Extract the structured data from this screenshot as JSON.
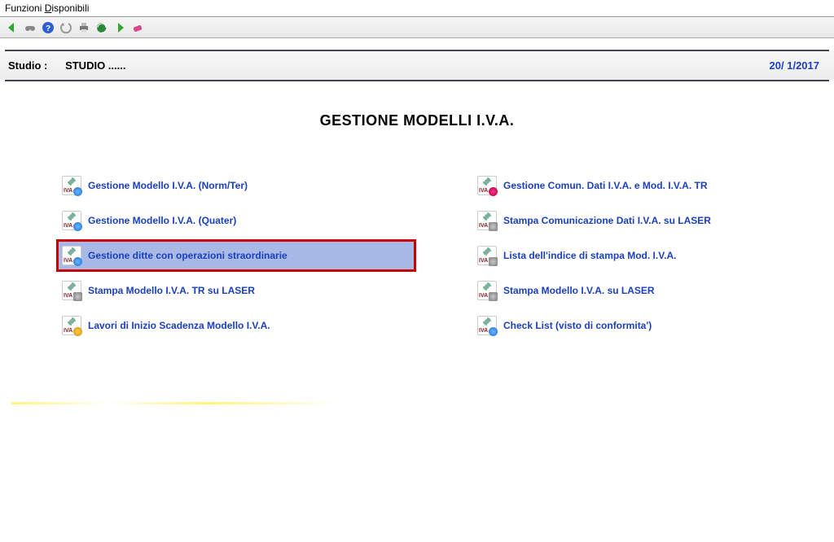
{
  "window": {
    "title_prefix": "Funzioni ",
    "title_underlined": "D",
    "title_suffix": "isponibili"
  },
  "toolbar": {
    "back": "back",
    "binoculars": "find",
    "help": "help",
    "undo": "undo",
    "print": "print",
    "refresh": "refresh",
    "forward": "forward",
    "delete": "delete"
  },
  "info": {
    "studio_label": "Studio :",
    "studio_value": "STUDIO ......",
    "date": "20/ 1/2017"
  },
  "page_title": "GESTIONE MODELLI I.V.A.",
  "left_items": [
    {
      "label": "Gestione Modello I.V.A. (Norm/Ter)",
      "badge": "blue"
    },
    {
      "label": "Gestione Modello I.V.A. (Quater)",
      "badge": "blue"
    },
    {
      "label": "Gestione ditte con operazioni straordinarie",
      "badge": "blue",
      "selected": true
    },
    {
      "label": "Stampa Modello I.V.A. TR su LASER",
      "badge": "print"
    },
    {
      "label": "Lavori di Inizio Scadenza Modello I.V.A.",
      "badge": "orange"
    }
  ],
  "right_items": [
    {
      "label": "Gestione Comun. Dati I.V.A. e Mod. I.V.A. TR",
      "badge": "tools"
    },
    {
      "label": "Stampa Comunicazione Dati I.V.A. su LASER",
      "badge": "print"
    },
    {
      "label": "Lista dell'indice di stampa Mod. I.V.A.",
      "badge": "print"
    },
    {
      "label": "Stampa Modello I.V.A. su LASER",
      "badge": "print"
    },
    {
      "label": "Check List (visto di conformita')",
      "badge": "blue"
    }
  ]
}
